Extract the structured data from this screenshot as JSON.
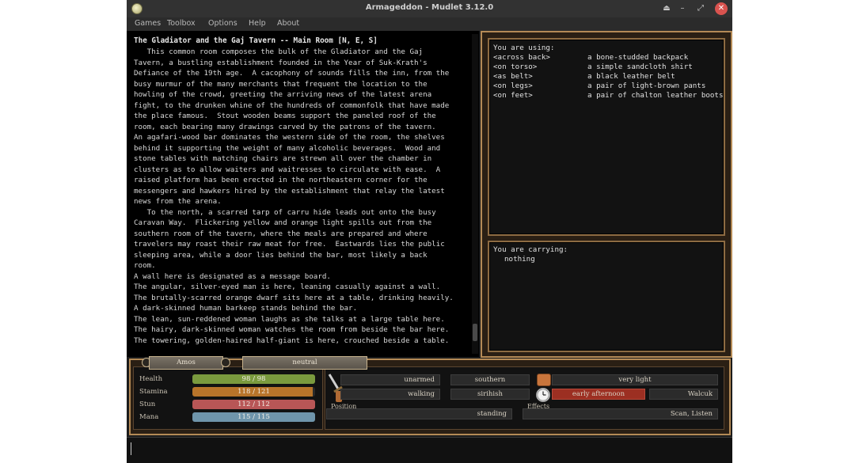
{
  "window": {
    "title": "Armageddon - Mudlet 3.12.0"
  },
  "titlebar_buttons": [
    "⏏",
    "–",
    "⤢",
    "✕"
  ],
  "menu": [
    "Games",
    "Toolbox",
    "Options",
    "Help",
    "About"
  ],
  "room": {
    "title": "The Gladiator and the Gaj Tavern -- Main Room [N, E, S]",
    "lines": [
      "   This common room composes the bulk of the Gladiator and the Gaj",
      "Tavern, a bustling establishment founded in the Year of Suk-Krath's",
      "Defiance of the 19th age.  A cacophony of sounds fills the inn, from the",
      "busy murmur of the many merchants that frequent the location to the",
      "howling of the crowd, greeting the arriving news of the latest arena",
      "fight, to the drunken whine of the hundreds of commonfolk that have made",
      "the place famous.  Stout wooden beams support the paneled roof of the",
      "room, each bearing many drawings carved by the patrons of the tavern.",
      "An agafari-wood bar dominates the western side of the room, the shelves",
      "behind it supporting the weight of many alcoholic beverages.  Wood and",
      "stone tables with matching chairs are strewn all over the chamber in",
      "clusters as to allow waiters and waitresses to circulate with ease.  A",
      "raised platform has been erected in the northeastern corner for the",
      "messengers and hawkers hired by the establishment that relay the latest",
      "news from the arena.",
      "   To the north, a scarred tarp of carru hide leads out onto the busy",
      "Caravan Way.  Flickering yellow and orange light spills out from the",
      "southern room of the tavern, where the meals are prepared and where",
      "travelers may roast their raw meat for free.  Eastwards lies the public",
      "sleeping area, while a door lies behind the bar, most likely a back",
      "room.",
      "A wall here is designated as a message board.",
      "The angular, silver-eyed man is here, leaning casually against a wall.",
      "The brutally-scarred orange dwarf sits here at a table, drinking heavily.",
      "A dark-skinned human barkeep stands behind the bar.",
      "The lean, sun-reddened woman laughs as she talks at a large table here.",
      "The hairy, dark-skinned woman watches the room from beside the bar here.",
      "The towering, golden-haired half-giant is here, crouched beside a table."
    ]
  },
  "equipment": {
    "header": "You are using:",
    "items": [
      {
        "slot": "<across back>",
        "item": "a bone-studded backpack"
      },
      {
        "slot": "<on torso>",
        "item": "a simple sandcloth shirt"
      },
      {
        "slot": "<as belt>",
        "item": "a black leather belt"
      },
      {
        "slot": "<on legs>",
        "item": "a pair of light-brown pants"
      },
      {
        "slot": "<on feet>",
        "item": "a pair of chalton leather boots"
      }
    ]
  },
  "inventory": {
    "header": "You are carrying:",
    "items": [
      "nothing"
    ]
  },
  "tabs": {
    "character": "Amos",
    "stance": "neutral"
  },
  "vitals": [
    {
      "label": "Health",
      "value": "98 / 98",
      "fraction": 1.0,
      "color": "#7a9a3e"
    },
    {
      "label": "Stamina",
      "value": "118 / 121",
      "fraction": 0.975,
      "color": "#b8742a"
    },
    {
      "label": "Stun",
      "value": "112 / 112",
      "fraction": 1.0,
      "color": "#b85656"
    },
    {
      "label": "Mana",
      "value": "115 / 115",
      "fraction": 1.0,
      "color": "#6f95ab"
    }
  ],
  "status": {
    "weapon": "unarmed",
    "movement": "walking",
    "direction": "southern",
    "language": "sirihish",
    "light": "very light",
    "time": "early afternoon",
    "watching": "Walcuk",
    "position_label": "Position",
    "position": "standing",
    "effects_label": "Effects",
    "effects": "Scan, Listen"
  },
  "colors": {
    "frame": "#b48a56",
    "time_highlight": "#9c2f22"
  }
}
